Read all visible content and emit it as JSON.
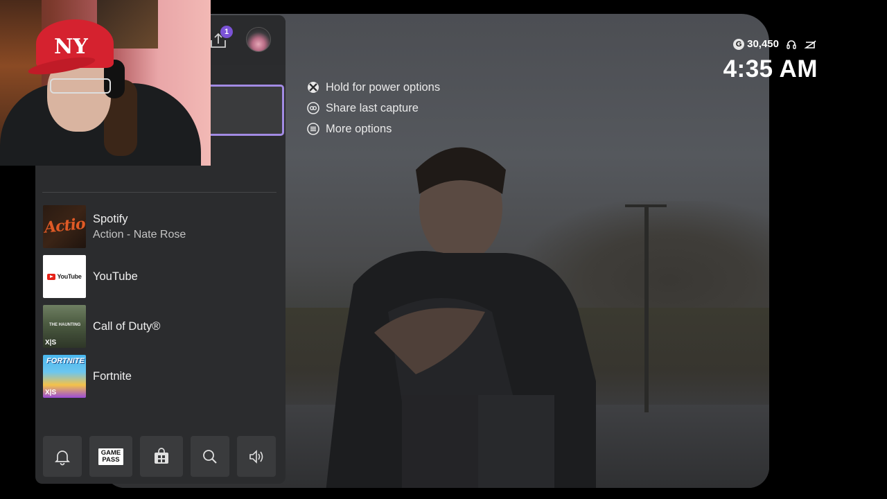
{
  "overlay_menu": [
    {
      "label": "Hold for power options",
      "icon": "xbox-button-icon"
    },
    {
      "label": "Share last capture",
      "icon": "share-icon"
    },
    {
      "label": "More options",
      "icon": "menu-icon"
    }
  ],
  "status": {
    "gamerscore": "30,450",
    "time": "4:35 AM",
    "icons": [
      "gamerscore-icon",
      "headset-icon",
      "battery-icon"
    ]
  },
  "guide": {
    "notification_count": "1",
    "recent_apps": [
      {
        "name": "Spotify",
        "subtitle": "Action - Nate Rose",
        "thumb": "spotify",
        "art_text": "Action"
      },
      {
        "name": "YouTube",
        "subtitle": "",
        "thumb": "youtube",
        "art_text": "YouTube"
      },
      {
        "name": "Call of Duty®",
        "subtitle": "",
        "thumb": "cod",
        "art_text": "THE HAUNTING",
        "badge": "X|S"
      },
      {
        "name": "Fortnite",
        "subtitle": "",
        "thumb": "fortnite",
        "art_text": "FORTNITE",
        "badge": "X|S"
      }
    ],
    "bottom_bar": [
      {
        "name": "notifications",
        "icon": "bell-icon"
      },
      {
        "name": "game-pass",
        "icon": "game-pass-icon",
        "label_top": "GAME",
        "label_bottom": "PASS"
      },
      {
        "name": "store",
        "icon": "store-icon"
      },
      {
        "name": "search",
        "icon": "search-icon"
      },
      {
        "name": "audio",
        "icon": "speaker-icon"
      }
    ]
  },
  "colors": {
    "guide_bg": "#2b2c2e",
    "focus_ring": "#a28be4",
    "badge": "#7b53d6"
  }
}
